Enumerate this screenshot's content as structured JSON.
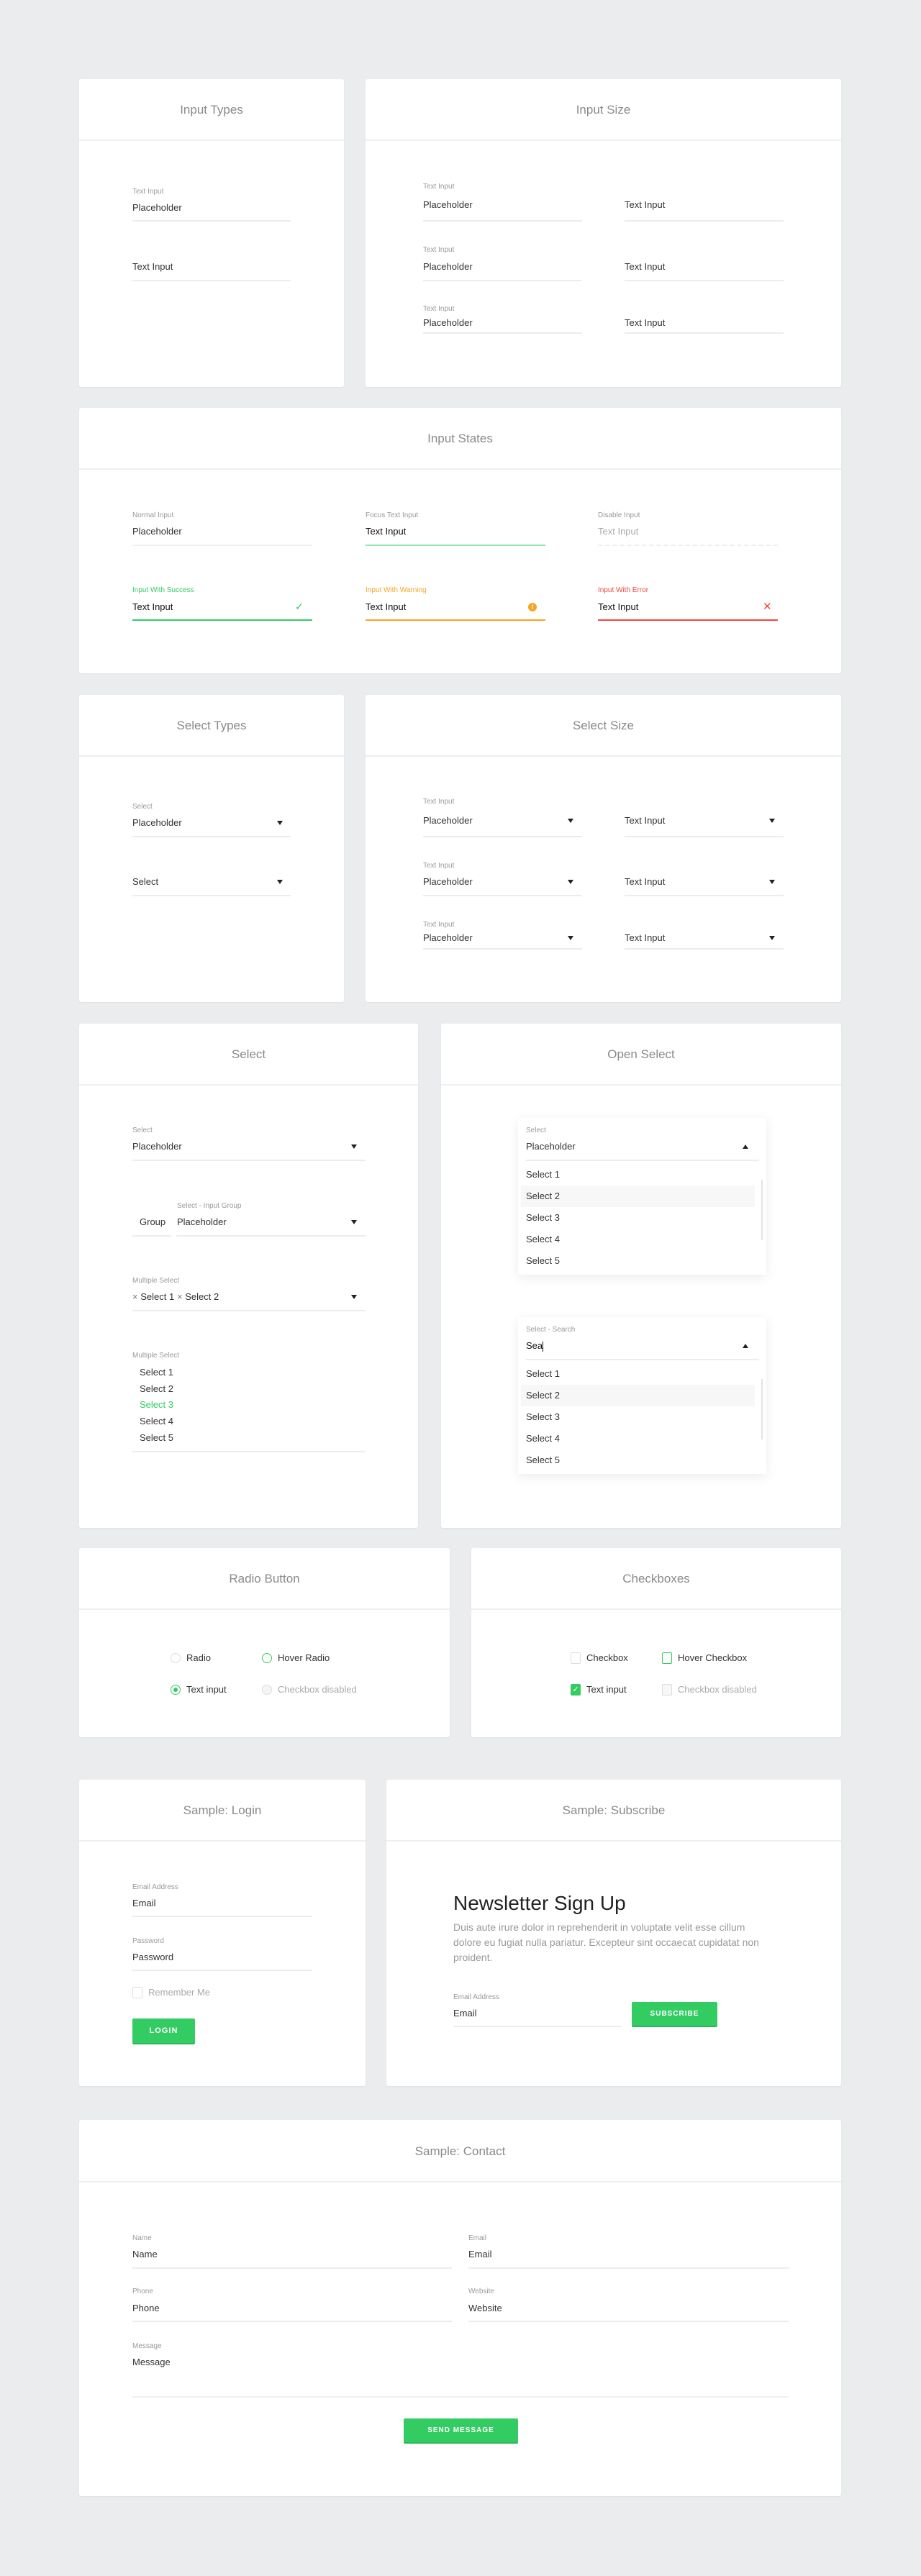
{
  "colors": {
    "background": "#ebecee",
    "accent": "#33cc62",
    "warning": "#f5a623",
    "error": "#f0483e"
  },
  "input_types": {
    "title": "Input Types",
    "field1": {
      "label": "Text Input",
      "value": "Placeholder"
    },
    "field2": {
      "value": "Text Input"
    }
  },
  "input_size": {
    "title": "Input Size",
    "rows": [
      {
        "label": "Text Input",
        "left": "Placeholder",
        "right": "Text Input"
      },
      {
        "label": "Text Input",
        "left": "Placeholder",
        "right": "Text Input"
      },
      {
        "label": "Text Input",
        "left": "Placeholder",
        "right": "Text Input"
      }
    ]
  },
  "input_states": {
    "title": "Input States",
    "normal": {
      "label": "Normal Input",
      "value": "Placeholder"
    },
    "focus": {
      "label": "Focus Text Input",
      "value": "Text Input"
    },
    "disabled": {
      "label": "Disable Input",
      "value": "Text Input"
    },
    "success": {
      "label": "Input With Success",
      "value": "Text Input",
      "icon": "check-icon"
    },
    "warning": {
      "label": "Input With Warning",
      "value": "Text Input",
      "icon": "warning-icon"
    },
    "error": {
      "label": "Input With Error",
      "value": "Text Input",
      "icon": "close-icon"
    }
  },
  "select_types": {
    "title": "Select Types",
    "field1": {
      "label": "Select",
      "value": "Placeholder"
    },
    "field2": {
      "value": "Select"
    }
  },
  "select_size": {
    "title": "Select Size",
    "rows": [
      {
        "label": "Text Input",
        "left": "Placeholder",
        "right": "Text Input"
      },
      {
        "label": "Text Input",
        "left": "Placeholder",
        "right": "Text Input"
      },
      {
        "label": "Text Input",
        "left": "Placeholder",
        "right": "Text Input"
      }
    ]
  },
  "select": {
    "title": "Select",
    "basic": {
      "label": "Select",
      "value": "Placeholder"
    },
    "group": {
      "label": "Select - Input Group",
      "addon": "Group",
      "value": "Placeholder"
    },
    "multiple": {
      "label": "Multiple Select",
      "chips": [
        "Select 1",
        "Select 2"
      ],
      "chip_remove": "×"
    },
    "list": {
      "label": "Multiple Select",
      "items": [
        "Select 1",
        "Select 2",
        "Select 3",
        "Select 4",
        "Select 5"
      ],
      "selected": "Select 3"
    }
  },
  "open_select": {
    "title": "Open Select",
    "select": {
      "label": "Select",
      "value": "Placeholder",
      "options": [
        "Select 1",
        "Select 2",
        "Select 3",
        "Select 4",
        "Select 5"
      ],
      "hovered": "Select 2"
    },
    "search": {
      "label": "Select - Search",
      "value": "Sea",
      "options": [
        "Select 1",
        "Select 2",
        "Select 3",
        "Select 4",
        "Select 5"
      ],
      "hovered": "Select 2"
    }
  },
  "radio": {
    "title": "Radio Button",
    "items": [
      {
        "label": "Radio",
        "state": "default"
      },
      {
        "label": "Hover Radio",
        "state": "hover"
      },
      {
        "label": "Text input",
        "state": "checked"
      },
      {
        "label": "Checkbox disabled",
        "state": "disabled"
      }
    ]
  },
  "checkboxes": {
    "title": "Checkboxes",
    "items": [
      {
        "label": "Checkbox",
        "state": "default"
      },
      {
        "label": "Hover Checkbox",
        "state": "hover"
      },
      {
        "label": "Text input",
        "state": "checked"
      },
      {
        "label": "Checkbox disabled",
        "state": "disabled"
      }
    ]
  },
  "login": {
    "title": "Sample: Login",
    "email": {
      "label": "Email Address",
      "value": "Email"
    },
    "password": {
      "label": "Password",
      "value": "Password"
    },
    "remember": "Remember Me",
    "button": "LOGIN"
  },
  "subscribe": {
    "title": "Sample: Subscribe",
    "heading": "Newsletter Sign Up",
    "text": "Duis aute irure dolor in reprehenderit in voluptate velit esse cillum dolore eu fugiat nulla pariatur. Excepteur sint occaecat cupidatat non proident.",
    "email": {
      "label": "Email Address",
      "value": "Email"
    },
    "button": "SUBSCRIBE"
  },
  "contact": {
    "title": "Sample: Contact",
    "name": {
      "label": "Name",
      "value": "Name"
    },
    "email": {
      "label": "Email",
      "value": "Email"
    },
    "phone": {
      "label": "Phone",
      "value": "Phone"
    },
    "website": {
      "label": "Website",
      "value": "Website"
    },
    "message": {
      "label": "Message",
      "value": "Message"
    },
    "button": "SEND MESSAGE"
  }
}
